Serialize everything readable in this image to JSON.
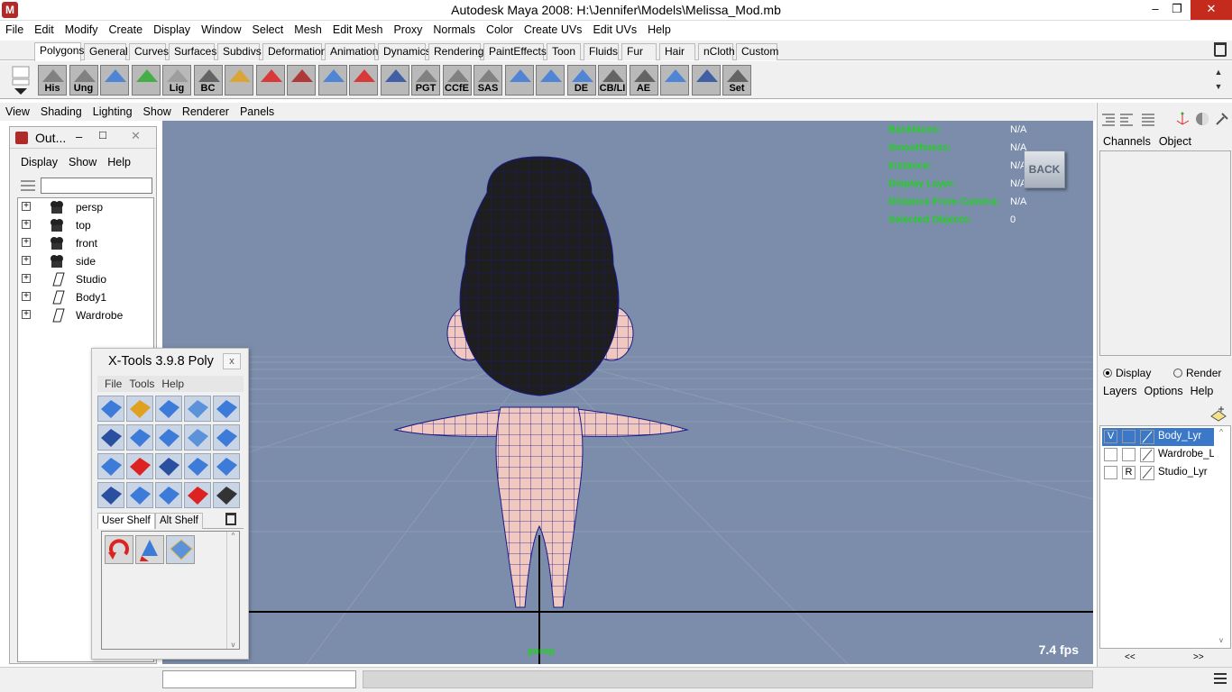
{
  "window": {
    "title": "Autodesk Maya 2008: H:\\Jennifer\\Models\\Melissa_Mod.mb",
    "logo": "M",
    "minimize": "–",
    "maximize": "❐",
    "close": "✕"
  },
  "menubar": [
    "File",
    "Edit",
    "Modify",
    "Create",
    "Display",
    "Window",
    "Select",
    "Mesh",
    "Edit Mesh",
    "Proxy",
    "Normals",
    "Color",
    "Create UVs",
    "Edit UVs",
    "Help"
  ],
  "shelf_tabs": [
    "Polygons",
    "General",
    "Curves",
    "Surfaces",
    "Subdivs",
    "Deformation",
    "Animation",
    "Dynamics",
    "Rendering",
    "PaintEffects",
    "Toon",
    "Fluids",
    "Fur",
    "Hair",
    "nCloth",
    "Custom"
  ],
  "shelf_buttons": [
    "His",
    "Ung",
    "",
    "",
    "Lig",
    "BC",
    "",
    "",
    "",
    "",
    "",
    "",
    "PGT",
    "CCfE",
    "SAS",
    "",
    "",
    "DE",
    "CB/LI",
    "AE",
    "",
    "",
    "Set"
  ],
  "shelf_scroll": {
    "up": "▲",
    "down": "▼"
  },
  "panel_menu": [
    "View",
    "Shading",
    "Lighting",
    "Show",
    "Renderer",
    "Panels"
  ],
  "hud": {
    "rows": [
      {
        "k": "Backfaces:",
        "v": "N/A"
      },
      {
        "k": "Smoothness:",
        "v": "N/A"
      },
      {
        "k": "Instance:",
        "v": "N/A"
      },
      {
        "k": "Display Layer:",
        "v": "N/A"
      },
      {
        "k": "Distance From Camera:",
        "v": "N/A"
      },
      {
        "k": "Selected Objects:",
        "v": "0"
      }
    ],
    "back_label": "BACK",
    "fps": "7.4 fps",
    "camera": "persp"
  },
  "outliner": {
    "title": "Out...",
    "minimize": "–",
    "maximize": "□",
    "close": "✕",
    "menu": [
      "Display",
      "Show",
      "Help"
    ],
    "items": [
      {
        "label": "persp",
        "type": "camera"
      },
      {
        "label": "top",
        "type": "camera"
      },
      {
        "label": "front",
        "type": "camera"
      },
      {
        "label": "side",
        "type": "camera"
      },
      {
        "label": "Studio",
        "type": "set"
      },
      {
        "label": "Body1",
        "type": "set"
      },
      {
        "label": "Wardrobe",
        "type": "set"
      }
    ],
    "expand": "+"
  },
  "xtools": {
    "title": "X-Tools 3.9.8 Poly",
    "close": "x",
    "menu": [
      "File",
      "Tools",
      "Help"
    ],
    "tabs": [
      "User Shelf",
      "Alt Shelf"
    ],
    "scroll": {
      "up": "^",
      "down": "v"
    }
  },
  "right_panel": {
    "channels_menu": [
      "Channels",
      "Object"
    ],
    "layer_mode": [
      {
        "label": "Display",
        "checked": true
      },
      {
        "label": "Render",
        "checked": false
      }
    ],
    "layer_menu": [
      "Layers",
      "Options",
      "Help"
    ],
    "layers": [
      {
        "v": "V",
        "p": "",
        "name": "Body_Lyr",
        "selected": true
      },
      {
        "v": "",
        "p": "",
        "name": "Wardrobe_Lyr",
        "selected": false
      },
      {
        "v": "",
        "p": "R",
        "name": "Studio_Lyr",
        "selected": false
      }
    ],
    "nav_left": "<<",
    "nav_right": ">>",
    "scroll": {
      "up": "^",
      "down": "v"
    }
  },
  "colors": {
    "viewport": "#7b8daa",
    "hud_key": "#1fd21f",
    "selection": "#3b78c8",
    "skin": "#f0c8c0",
    "hair": "#222222",
    "wire": "#1a1a8a"
  }
}
